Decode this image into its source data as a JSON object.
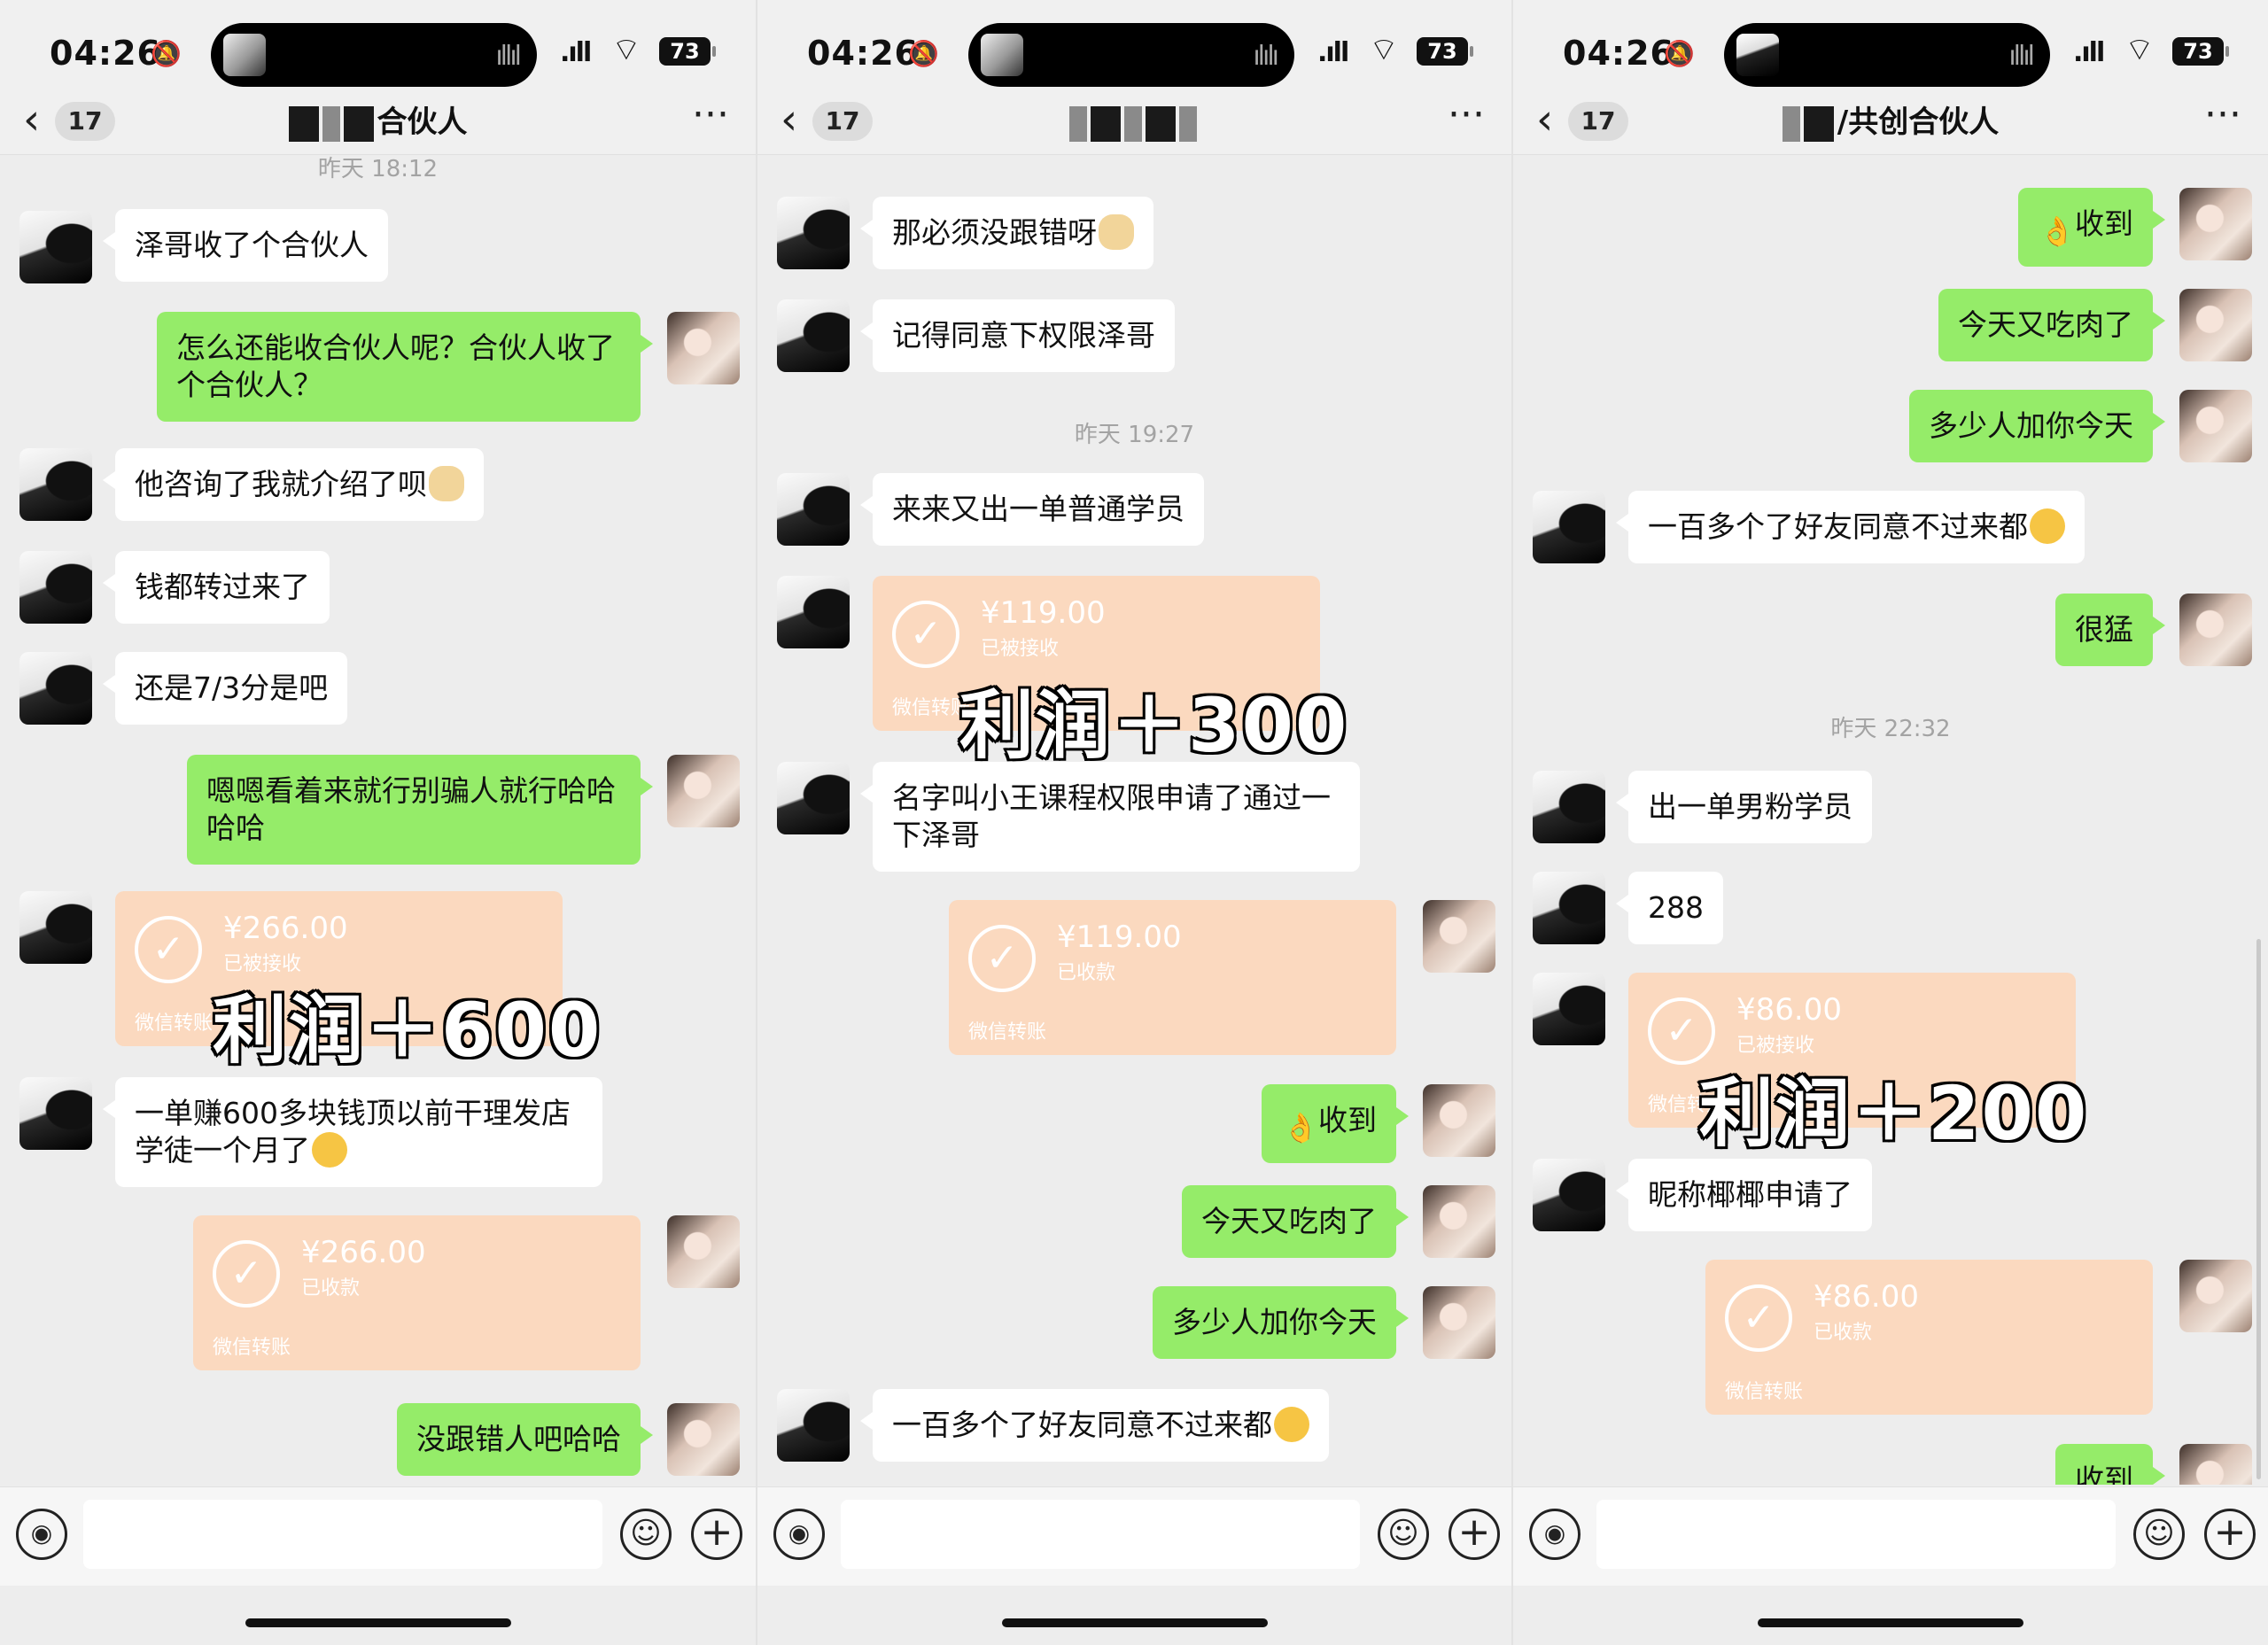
{
  "panels": [
    {
      "status": {
        "time": "04:26",
        "battery": "73"
      },
      "nav": {
        "count": "17",
        "title_visible": "合伙人"
      },
      "timestamps": [
        "昨天 18:12"
      ],
      "messages": [
        {
          "side": "left",
          "text": "泽哥收了个合伙人"
        },
        {
          "side": "right",
          "text": "怎么还能收合伙人呢？合伙人收了个合伙人？"
        },
        {
          "side": "left",
          "text": "他咨询了我就介绍了呗",
          "emoji": "dog"
        },
        {
          "side": "left",
          "text": "钱都转过来了"
        },
        {
          "side": "left",
          "text": "还是7/3分是吧"
        },
        {
          "side": "right",
          "text": "嗯嗯看着来就行别骗人就行哈哈哈哈"
        },
        {
          "side": "left",
          "transfer": {
            "amount": "¥266.00",
            "status": "已被接收",
            "footer": "微信转账"
          }
        },
        {
          "side": "left",
          "text": "一单赚600多块钱顶以前干理发店学徒一个月了",
          "emoji": "smile"
        },
        {
          "side": "right",
          "transfer": {
            "amount": "¥266.00",
            "status": "已收款",
            "footer": "微信转账"
          }
        },
        {
          "side": "right",
          "text": "没跟错人吧哈哈"
        }
      ],
      "overlay": "利润＋600"
    },
    {
      "status": {
        "time": "04:26",
        "battery": "73"
      },
      "nav": {
        "count": "17",
        "title_visible": ""
      },
      "timestamps": [
        "昨天 19:27"
      ],
      "messages": [
        {
          "side": "left",
          "text": "那必须没跟错呀",
          "emoji": "dog"
        },
        {
          "side": "left",
          "text": "记得同意下权限泽哥"
        },
        {
          "side": "left",
          "text": "来来又出一单普通学员"
        },
        {
          "side": "left",
          "transfer": {
            "amount": "¥119.00",
            "status": "已被接收",
            "footer": "微信转账"
          }
        },
        {
          "side": "left",
          "text": "名字叫小王课程权限申请了通过一下泽哥"
        },
        {
          "side": "right",
          "transfer": {
            "amount": "¥119.00",
            "status": "已收款",
            "footer": "微信转账"
          }
        },
        {
          "side": "right",
          "text": "收到",
          "emoji": "ok"
        },
        {
          "side": "right",
          "text": "今天又吃肉了"
        },
        {
          "side": "right",
          "text": "多少人加你今天"
        },
        {
          "side": "left",
          "text": "一百多个了好友同意不过来都",
          "emoji": "sweat"
        }
      ],
      "overlay": "利润＋300"
    },
    {
      "status": {
        "time": "04:26",
        "battery": "73"
      },
      "nav": {
        "count": "17",
        "title_visible": "/共创合伙人"
      },
      "timestamps": [
        "昨天 22:32"
      ],
      "messages": [
        {
          "side": "right",
          "text": "收到",
          "emoji": "ok"
        },
        {
          "side": "right",
          "text": "今天又吃肉了"
        },
        {
          "side": "right",
          "text": "多少人加你今天"
        },
        {
          "side": "left",
          "text": "一百多个了好友同意不过来都",
          "emoji": "sweat"
        },
        {
          "side": "right",
          "text": "很猛"
        },
        {
          "side": "left",
          "text": "出一单男粉学员"
        },
        {
          "side": "left",
          "text": "288"
        },
        {
          "side": "left",
          "transfer": {
            "amount": "¥86.00",
            "status": "已被接收",
            "footer": "微信转账"
          }
        },
        {
          "side": "left",
          "text": "昵称椰椰申请了"
        },
        {
          "side": "right",
          "transfer": {
            "amount": "¥86.00",
            "status": "已收款",
            "footer": "微信转账"
          }
        },
        {
          "side": "right",
          "text": "收到"
        }
      ],
      "overlay": "利润＋200"
    }
  ],
  "colors": {
    "sent": "#95ec69",
    "received": "#ffffff",
    "transfer": "#fbd9bf",
    "background": "#ededed"
  }
}
